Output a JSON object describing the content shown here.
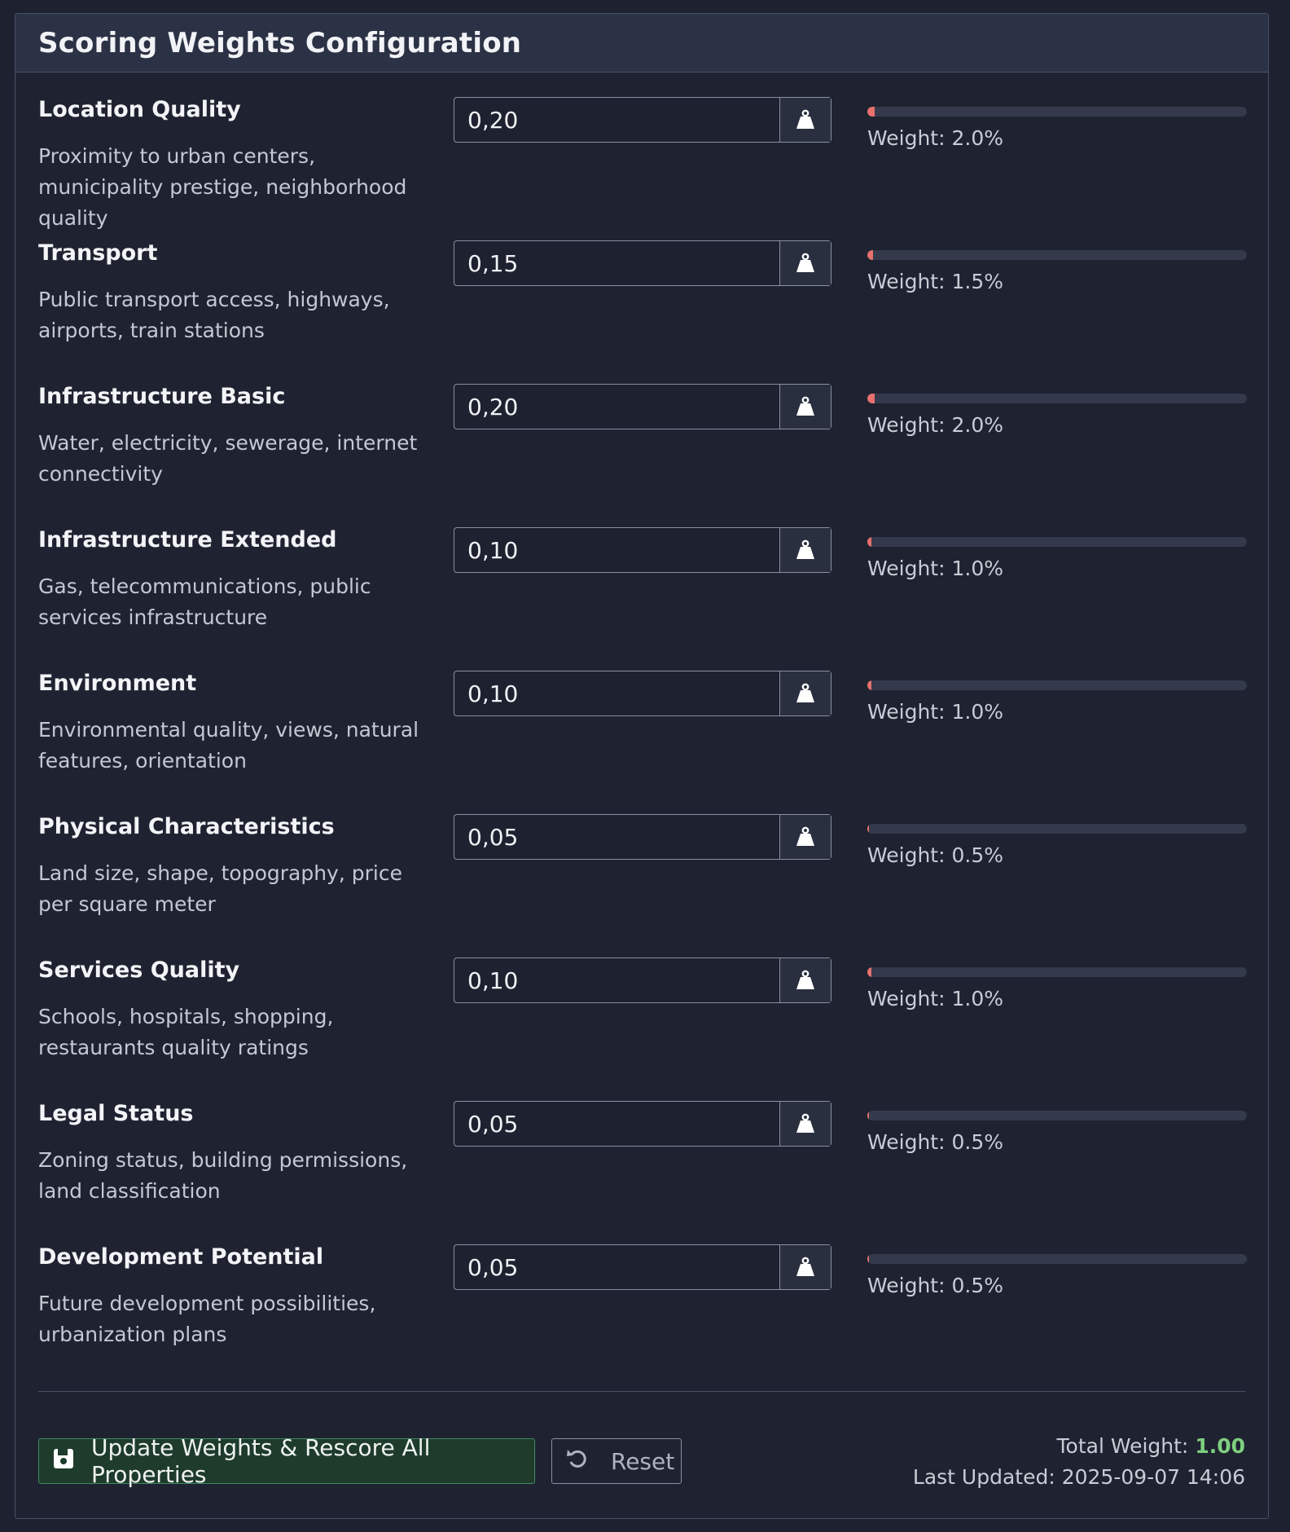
{
  "panel": {
    "title": "Scoring Weights Configuration"
  },
  "colors": {
    "bar_fill": "#e8716d",
    "total_value": "#7ed07f",
    "primary_button_border": "#3f8a5e"
  },
  "weights": [
    {
      "name": "Location Quality",
      "description": "Proximity to urban centers, municipality prestige, neighborhood quality",
      "value": "0,20",
      "weight_label": "Weight: 2.0%",
      "weight_percent": 2.0,
      "icon": "weight-icon"
    },
    {
      "name": "Transport",
      "description": "Public transport access, highways, airports, train stations",
      "value": "0,15",
      "weight_label": "Weight: 1.5%",
      "weight_percent": 1.5,
      "icon": "weight-icon"
    },
    {
      "name": "Infrastructure Basic",
      "description": "Water, electricity, sewerage, internet connectivity",
      "value": "0,20",
      "weight_label": "Weight: 2.0%",
      "weight_percent": 2.0,
      "icon": "weight-icon"
    },
    {
      "name": "Infrastructure Extended",
      "description": "Gas, telecommunications, public services infrastructure",
      "value": "0,10",
      "weight_label": "Weight: 1.0%",
      "weight_percent": 1.0,
      "icon": "weight-icon"
    },
    {
      "name": "Environment",
      "description": "Environmental quality, views, natural features, orientation",
      "value": "0,10",
      "weight_label": "Weight: 1.0%",
      "weight_percent": 1.0,
      "icon": "weight-icon"
    },
    {
      "name": "Physical Characteristics",
      "description": "Land size, shape, topography, price per square meter",
      "value": "0,05",
      "weight_label": "Weight: 0.5%",
      "weight_percent": 0.5,
      "icon": "weight-icon"
    },
    {
      "name": "Services Quality",
      "description": "Schools, hospitals, shopping, restaurants quality ratings",
      "value": "0,10",
      "weight_label": "Weight: 1.0%",
      "weight_percent": 1.0,
      "icon": "weight-icon"
    },
    {
      "name": "Legal Status",
      "description": "Zoning status, building permissions, land classification",
      "value": "0,05",
      "weight_label": "Weight: 0.5%",
      "weight_percent": 0.5,
      "icon": "weight-icon"
    },
    {
      "name": "Development Potential",
      "description": "Future development possibilities, urbanization plans",
      "value": "0,05",
      "weight_label": "Weight: 0.5%",
      "weight_percent": 0.5,
      "icon": "weight-icon"
    }
  ],
  "actions": {
    "update_label": "Update Weights & Rescore All Properties",
    "update_icon": "save-icon",
    "reset_label": "Reset",
    "reset_icon": "undo-icon"
  },
  "footer": {
    "total_label": "Total Weight:",
    "total_value": "1.00",
    "updated_label": "Last Updated:",
    "updated_value": "2025-09-07 14:06"
  }
}
